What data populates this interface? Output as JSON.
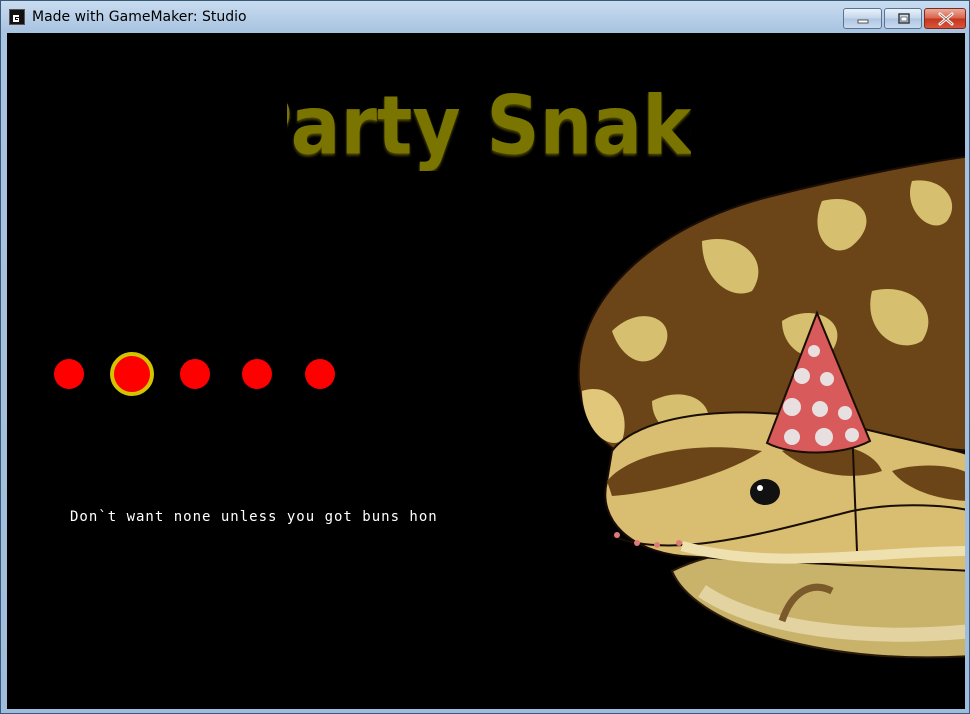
{
  "window": {
    "title": "Made with GameMaker: Studio"
  },
  "game": {
    "title": "Party Snake",
    "message": "Don`t want none unless you got buns hon",
    "menu_dots": [
      {
        "id": 1,
        "selected": false
      },
      {
        "id": 2,
        "selected": true
      },
      {
        "id": 3,
        "selected": false
      },
      {
        "id": 4,
        "selected": false
      },
      {
        "id": 5,
        "selected": false
      }
    ],
    "colors": {
      "background": "#000000",
      "title": "#7a7400",
      "dot": "#ff0000",
      "selection_ring": "#d4c400",
      "text": "#ffffff"
    }
  }
}
